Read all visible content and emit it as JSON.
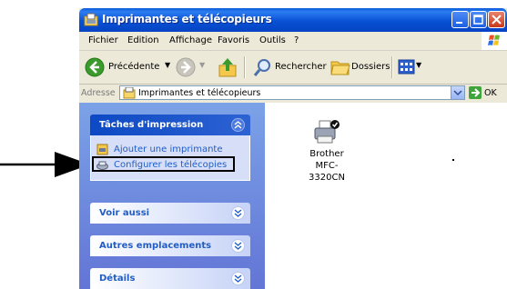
{
  "window": {
    "title": "Imprimantes et télécopieurs"
  },
  "menu": [
    "Fichier",
    "Edition",
    "Affichage",
    "Favoris",
    "Outils",
    "?"
  ],
  "toolbar": {
    "back": "Précédente",
    "search": "Rechercher",
    "folders": "Dossiers"
  },
  "address": {
    "label": "Adresse",
    "value": "Imprimantes et télécopieurs",
    "go": "OK"
  },
  "taskpane": {
    "print_tasks": {
      "title": "Tâches d'impression",
      "items": [
        "Ajouter une imprimante",
        "Configurer les télécopies"
      ]
    },
    "see_also": "Voir aussi",
    "other_places": "Autres emplacements",
    "details": "Détails"
  },
  "printer": {
    "line1": "Brother",
    "line2": "MFC-3320CN"
  },
  "colors": {
    "titlebar": "#0a5bd8",
    "taskpane": "#7ba2e7",
    "link": "#215dc6",
    "panel_header_special": "#0c49c3"
  }
}
